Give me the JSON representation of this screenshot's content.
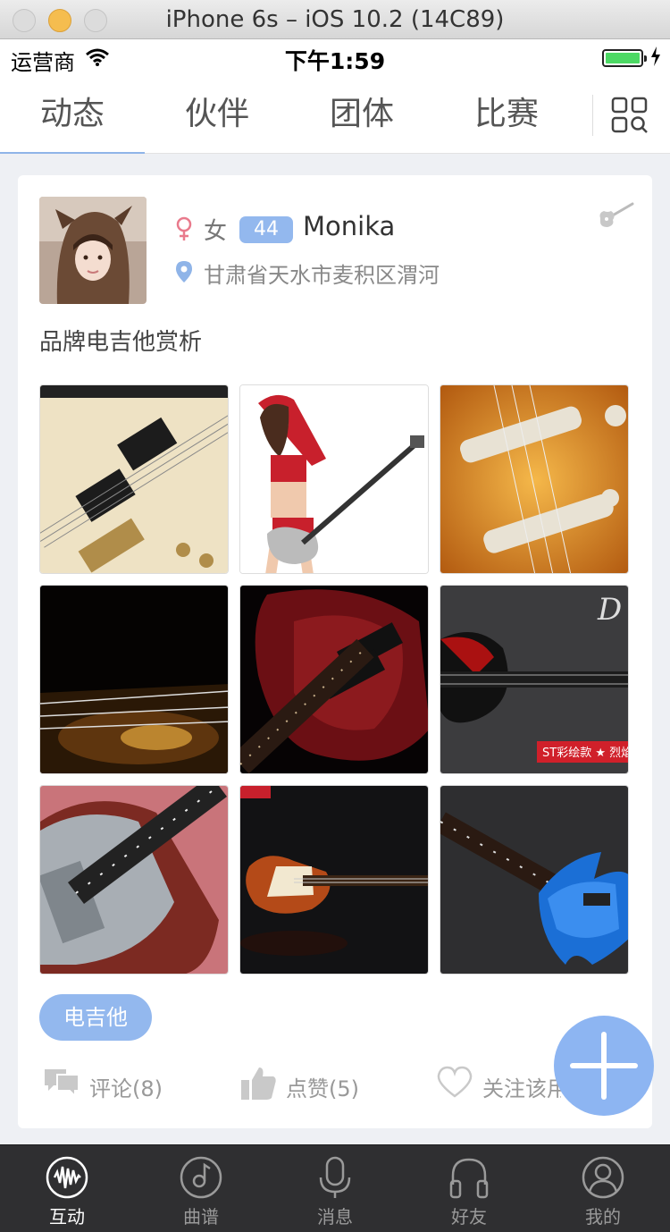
{
  "window": {
    "title": "iPhone 6s – iOS 10.2 (14C89)"
  },
  "status_bar": {
    "carrier": "运营商",
    "time": "下午1:59",
    "battery_level": 1.0
  },
  "top_tabs": [
    {
      "label": "动态",
      "active": true
    },
    {
      "label": "伙伴",
      "active": false
    },
    {
      "label": "团体",
      "active": false
    },
    {
      "label": "比赛",
      "active": false
    }
  ],
  "post": {
    "user": {
      "gender": "女",
      "level": "44",
      "name": "Monika",
      "location": "甘肃省天水市麦积区渭河"
    },
    "text": "品牌电吉他赏析",
    "photo_count": 9,
    "tag": "电吉他",
    "actions": {
      "comment": "评论(8)",
      "like": "点赞(5)",
      "follow": "关注该用"
    }
  },
  "bottom_tabs": [
    {
      "label": "互动",
      "icon": "waveform-icon",
      "active": true
    },
    {
      "label": "曲谱",
      "icon": "disc-icon",
      "active": false
    },
    {
      "label": "消息",
      "icon": "microphone-icon",
      "active": false
    },
    {
      "label": "好友",
      "icon": "headphones-icon",
      "active": false
    },
    {
      "label": "我的",
      "icon": "user-icon",
      "active": false
    }
  ],
  "colors": {
    "accent": "#8fb4e8",
    "tag_bg": "#93b8ee",
    "gender_female": "#e97a8c",
    "tabbar_bg": "#2f2f31"
  }
}
